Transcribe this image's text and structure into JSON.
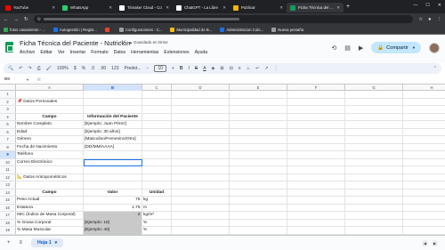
{
  "browser": {
    "tabs": [
      {
        "label": "YouTube",
        "color": "#ff0000",
        "active": false
      },
      {
        "label": "WhatsApp",
        "color": "#25d366",
        "active": false
      },
      {
        "label": "Tiimaker Cloud - Co",
        "color": "#ffffff",
        "active": false
      },
      {
        "label": "ChatGPT - La Libre",
        "color": "#ffffff",
        "active": false
      },
      {
        "label": "Publicar",
        "color": "#f4b400",
        "active": false
      },
      {
        "label": "Ficha Técnica del Pac",
        "color": "#0f9d58",
        "active": true
      }
    ],
    "new_tab": "+",
    "bookmarks": [
      {
        "label": "fotos casamiento - ...",
        "color": "#34a853"
      },
      {
        "label": "Autogestión | Regist...",
        "color": "#1a73e8"
      },
      {
        "label": "",
        "color": "#ea4335"
      },
      {
        "label": "Configuraciones - C...",
        "color": "#9aa0a6"
      },
      {
        "label": "Municipalidad de B...",
        "color": "#fbbc04"
      },
      {
        "label": "Administracion Colo...",
        "color": "#1a73e8"
      },
      {
        "label": "Nueva pestaña",
        "color": "#9aa0a6"
      }
    ]
  },
  "doc": {
    "title": "Ficha Técnica del Paciente - Nutrición",
    "saved_status": "Guardado en Drive",
    "menu": [
      "Archivo",
      "Editar",
      "Ver",
      "Insertar",
      "Formato",
      "Datos",
      "Herramientas",
      "Extensiones",
      "Ayuda"
    ],
    "share_label": "Compartir"
  },
  "toolbar": {
    "zoom": "100%",
    "currency": "$",
    "percent": "%",
    "decimals_less": ".0",
    "decimals_more": ".00",
    "number_format": "123",
    "font": "Predet...",
    "font_size": "10"
  },
  "formula_bar": {
    "cell_ref": "B9",
    "fx": "fx",
    "content": ""
  },
  "grid": {
    "columns": [
      "A",
      "B",
      "C",
      "D",
      "E",
      "F",
      "G",
      "H",
      "I"
    ],
    "selected_column": "B",
    "selected_row": "9",
    "rows": [
      {
        "n": "1",
        "cells": [
          "",
          "",
          "",
          ""
        ]
      },
      {
        "n": "2",
        "cells": [
          "📌 Datos Personales",
          "",
          "",
          ""
        ]
      },
      {
        "n": "3",
        "cells": [
          "",
          "",
          "",
          ""
        ]
      },
      {
        "n": "4",
        "cells": [
          "Campo",
          "Información del Paciente",
          "",
          ""
        ]
      },
      {
        "n": "5",
        "cells": [
          "Nombre Completo",
          "[Ejemplo: Juan Pérez]",
          "",
          ""
        ]
      },
      {
        "n": "6",
        "cells": [
          "Edad",
          "[Ejemplo: 30 años]",
          "",
          ""
        ]
      },
      {
        "n": "7",
        "cells": [
          "Género",
          "[Masculino/Femenino/Otro]",
          "",
          ""
        ]
      },
      {
        "n": "8",
        "cells": [
          "Fecha de Nacimiento",
          "[DD/MM/AAAA]",
          "",
          ""
        ]
      },
      {
        "n": "9",
        "cells": [
          "Teléfono",
          "",
          "",
          ""
        ]
      },
      {
        "n": "10",
        "cells": [
          "Correo Electrónico",
          "",
          "",
          ""
        ]
      },
      {
        "n": "11",
        "cells": [
          "",
          "",
          "",
          ""
        ]
      },
      {
        "n": "12",
        "cells": [
          "📐 Datos Antropométricos",
          "",
          "",
          ""
        ]
      },
      {
        "n": "13",
        "cells": [
          "",
          "",
          "",
          ""
        ]
      },
      {
        "n": "14",
        "cells": [
          "Campo",
          "Valor",
          "Unidad",
          ""
        ]
      },
      {
        "n": "15",
        "cells": [
          "Peso Actual",
          "75",
          "kg",
          ""
        ]
      },
      {
        "n": "16",
        "cells": [
          "Estatura",
          "1.75",
          "m",
          ""
        ]
      },
      {
        "n": "17",
        "cells": [
          "IMC (Índice de Masa Corporal)",
          "2",
          "kg/m²",
          ""
        ]
      },
      {
        "n": "18",
        "cells": [
          "% Grasa Corporal",
          "[Ejemplo: 18]",
          "%",
          ""
        ]
      },
      {
        "n": "19",
        "cells": [
          "% Masa Muscular",
          "[Ejemplo: 40]",
          "%",
          ""
        ]
      },
      {
        "n": "20",
        "cells": [
          "",
          "",
          "",
          ""
        ]
      },
      {
        "n": "21",
        "cells": [
          "🥗 Hábitos Alimenticios",
          "",
          "",
          ""
        ]
      }
    ]
  },
  "sheets": {
    "add": "+",
    "list": "≡",
    "tab_label": "Hoja 1"
  }
}
